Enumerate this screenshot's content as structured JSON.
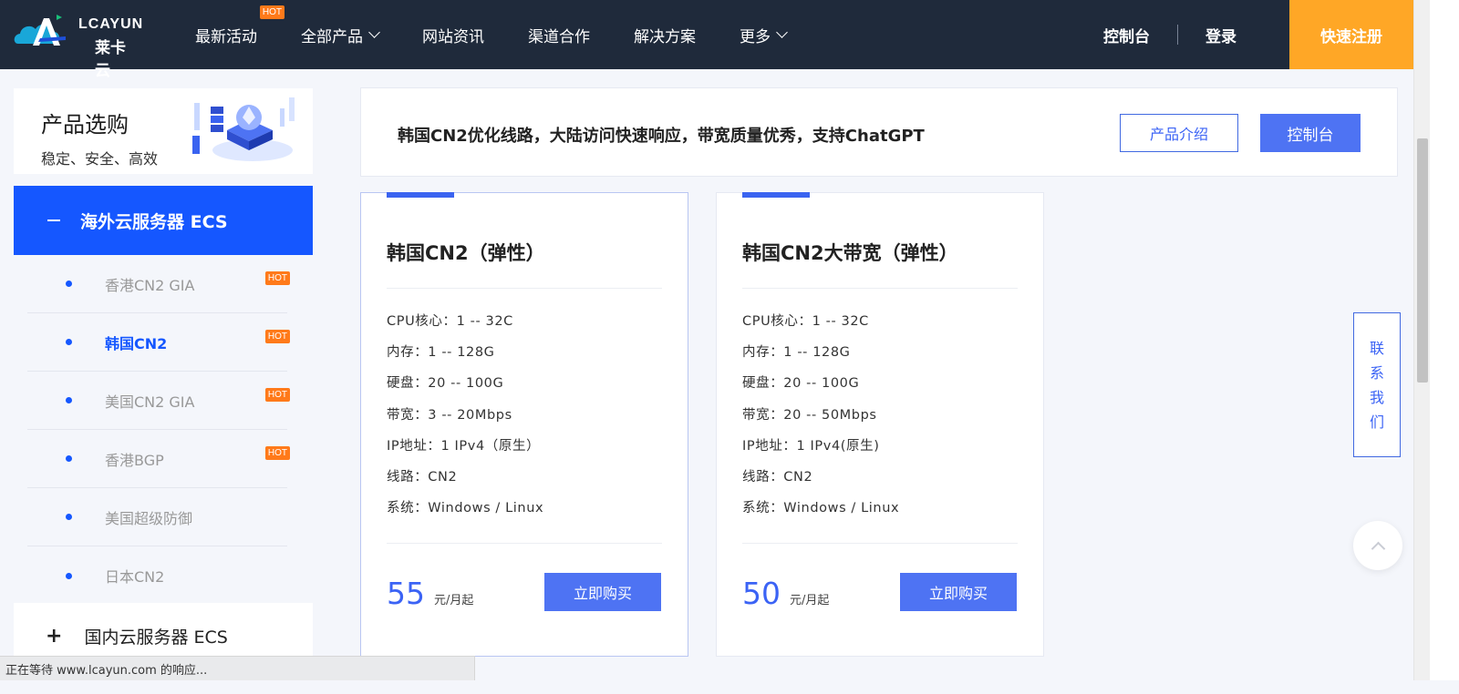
{
  "header": {
    "logo_en": "LCAYUN",
    "logo_cn": "莱卡云",
    "nav": [
      {
        "label": "最新活动",
        "hot": "HOT",
        "has_dropdown": false
      },
      {
        "label": "全部产品",
        "hot": "",
        "has_dropdown": true
      },
      {
        "label": "网站资讯",
        "hot": "",
        "has_dropdown": false
      },
      {
        "label": "渠道合作",
        "hot": "",
        "has_dropdown": false
      },
      {
        "label": "解决方案",
        "hot": "",
        "has_dropdown": false
      },
      {
        "label": "更多",
        "hot": "",
        "has_dropdown": true
      }
    ],
    "console": "控制台",
    "login": "登录",
    "register": "快速注册"
  },
  "sidebar": {
    "title": "产品选购",
    "subtitle": "稳定、安全、高效",
    "active_category": "海外云服务器 ECS",
    "items": [
      {
        "label": "香港CN2 GIA",
        "hot": "HOT",
        "current": false
      },
      {
        "label": "韩国CN2",
        "hot": "HOT",
        "current": true
      },
      {
        "label": "美国CN2 GIA",
        "hot": "HOT",
        "current": false
      },
      {
        "label": "香港BGP",
        "hot": "HOT",
        "current": false
      },
      {
        "label": "美国超级防御",
        "hot": "",
        "current": false
      },
      {
        "label": "日本CN2",
        "hot": "",
        "current": false
      }
    ],
    "other_category": "国内云服务器 ECS"
  },
  "banner": {
    "text": "韩国CN2优化线路，大陆访问快速响应，带宽质量优秀，支持ChatGPT",
    "intro_button": "产品介绍",
    "console_button": "控制台"
  },
  "products": [
    {
      "title": "韩国CN2（弹性）",
      "specs": [
        "CPU核心：1 -- 32C",
        "内存：1 -- 128G",
        "硬盘：20 -- 100G",
        "带宽：3 -- 20Mbps",
        "IP地址：1 IPv4（原生）",
        "线路：CN2",
        "系统：Windows / Linux"
      ],
      "price": "55",
      "unit": "元/月起",
      "buy": "立即购买"
    },
    {
      "title": "韩国CN2大带宽（弹性）",
      "specs": [
        "CPU核心：1 -- 32C",
        "内存：1 -- 128G",
        "硬盘：20 -- 100G",
        "带宽：20 -- 50Mbps",
        "IP地址：1 IPv4(原生)",
        "线路：CN2",
        "系统：Windows / Linux"
      ],
      "price": "50",
      "unit": "元/月起",
      "buy": "立即购买"
    }
  ],
  "contact": [
    "联",
    "系",
    "我",
    "们"
  ],
  "status": "正在等待 www.lcayun.com 的响应...",
  "colors": {
    "header_bg": "#1f2a3b",
    "accent": "#1557ff",
    "button": "#4e73f3",
    "register": "#ffa726",
    "hot": "#ff7a1a"
  }
}
